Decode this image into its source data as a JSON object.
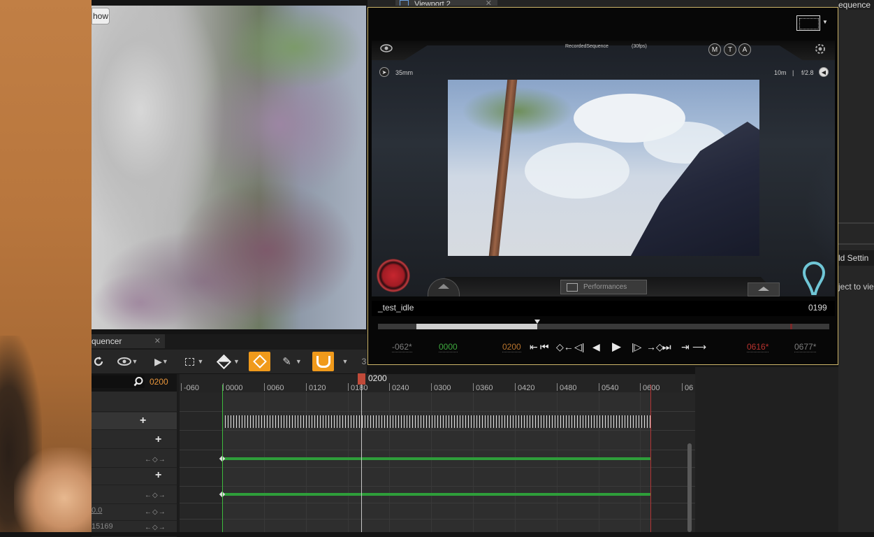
{
  "viewport1": {
    "show_label": "how"
  },
  "sequencer": {
    "tab_label": "quencer",
    "tab_close": "✕",
    "toolbar_partial": "3",
    "current_frame": "0200",
    "playhead_label": "0200",
    "ruler_ticks": [
      "-060",
      "0000",
      "0060",
      "0120",
      "0180",
      "0240",
      "0300",
      "0360",
      "0420",
      "0480",
      "0540",
      "0600",
      "06"
    ],
    "tree_values": [
      "0.0",
      "15169"
    ],
    "key_controls": "←◇→"
  },
  "viewport2": {
    "tab_label": "Viewport 2",
    "tab_close": "✕",
    "hud": {
      "sequence_name": "RecordedSequence",
      "fps": "(30fps)",
      "lens": "35mm",
      "focus_distance": "10m",
      "separator": "|",
      "aperture": "f/2.8",
      "mode_buttons": [
        "M",
        "T",
        "A"
      ],
      "performances_label": "Performances"
    },
    "take_name": "_test_idle",
    "take_frame": "0199",
    "transport": {
      "start_offset": "-062*",
      "start_frame": "0000",
      "current": "0200",
      "end_frame": "0616*",
      "end_offset": "0677*",
      "buttons": [
        "⇤",
        "⏮",
        "◇←",
        "◁|",
        "◀",
        "▶",
        "|▷",
        "→◇",
        "⏭",
        "⇥",
        "⟶"
      ]
    }
  },
  "right_panel": {
    "top_tab": "equence",
    "tab2": "ld Settin",
    "hint_text": "ject to vie"
  },
  "colors": {
    "accent_orange": "#f09a1b",
    "frame_orange": "#e8953a",
    "track_green": "#2e9e3a",
    "start_green": "#3dbb3d",
    "end_red": "#b33434",
    "playhead_red": "#c14a39",
    "window_border": "#ccb469"
  }
}
